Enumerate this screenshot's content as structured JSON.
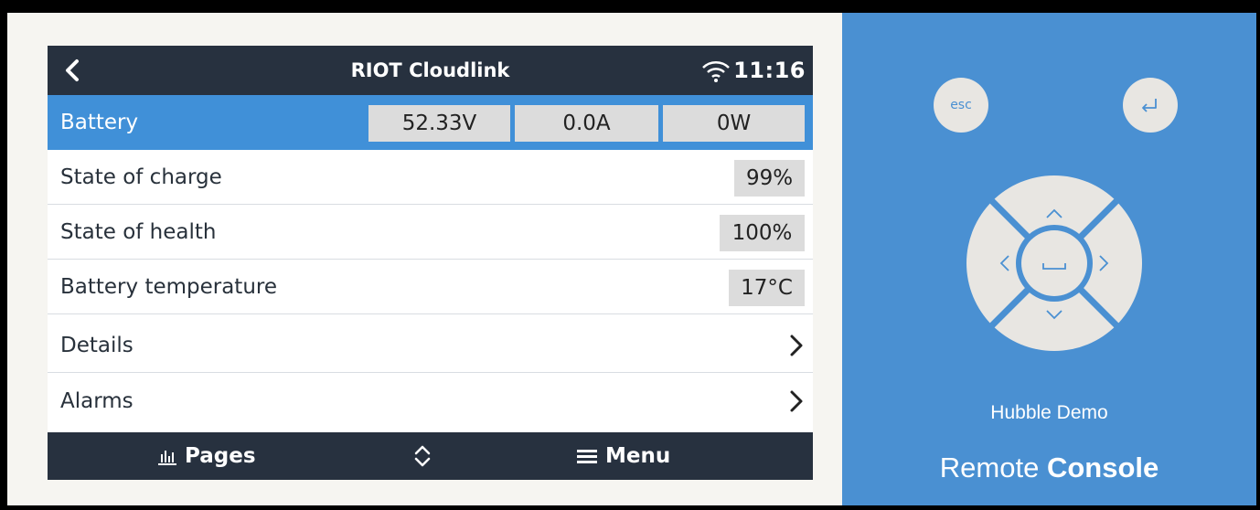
{
  "header": {
    "title": "RIOT Cloudlink",
    "time": "11:16"
  },
  "battery_row": {
    "label": "Battery",
    "voltage": "52.33V",
    "current": "0.0A",
    "power": "0W"
  },
  "rows": [
    {
      "label": "State of charge",
      "value": "99%"
    },
    {
      "label": "State of health",
      "value": "100%"
    },
    {
      "label": "Battery temperature",
      "value": "17°C"
    },
    {
      "label": "Details"
    },
    {
      "label": "Alarms"
    }
  ],
  "footer": {
    "pages_label": "Pages",
    "menu_label": "Menu"
  },
  "remote": {
    "esc_label": "esc",
    "device_name": "Hubble Demo",
    "console_prefix": "Remote",
    "console_suffix": "Console"
  },
  "colors": {
    "header_bg": "#27313f",
    "selected_bg": "#4090d8",
    "panel_bg": "#4a90d2"
  },
  "icons": [
    "back-icon",
    "wifi-icon",
    "chevron-right-icon",
    "chart-icon",
    "up-down-icon",
    "menu-icon",
    "enter-icon",
    "dpad-icon"
  ]
}
